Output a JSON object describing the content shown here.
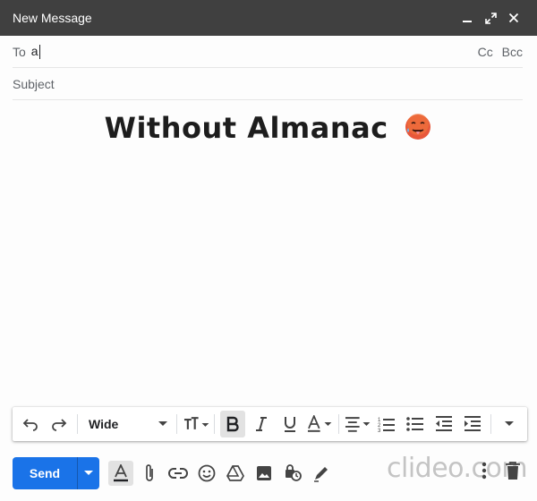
{
  "window": {
    "title": "New Message",
    "controls": [
      "minimize-icon",
      "expand-icon",
      "close-icon"
    ]
  },
  "to_field": {
    "label": "To",
    "value": "a",
    "cc": "Cc",
    "bcc": "Bcc"
  },
  "subject_field": {
    "placeholder": "Subject"
  },
  "body": {
    "heading": "Without Almanac",
    "emoji": "hot-face-emoji"
  },
  "format_toolbar": {
    "font": "Wide",
    "items": [
      "undo-icon",
      "redo-icon",
      "font-select",
      "text-size-icon",
      "bold-icon",
      "italic-icon",
      "underline-icon",
      "text-color-icon",
      "align-icon",
      "numbered-list-icon",
      "bulleted-list-icon",
      "indent-less-icon",
      "indent-more-icon",
      "more-formatting-icon"
    ],
    "bold_active": true
  },
  "bottom_toolbar": {
    "send_label": "Send",
    "watermark": "clideo.com",
    "items": [
      "formatting-options-icon",
      "attach-icon",
      "link-icon",
      "emoji-icon",
      "drive-icon",
      "photo-icon",
      "confidential-icon",
      "signature-icon",
      "more-options-icon",
      "trash-icon"
    ]
  },
  "colors": {
    "titlebar": "#404040",
    "send": "#1a73e8",
    "heading": "#1d1d1d"
  }
}
